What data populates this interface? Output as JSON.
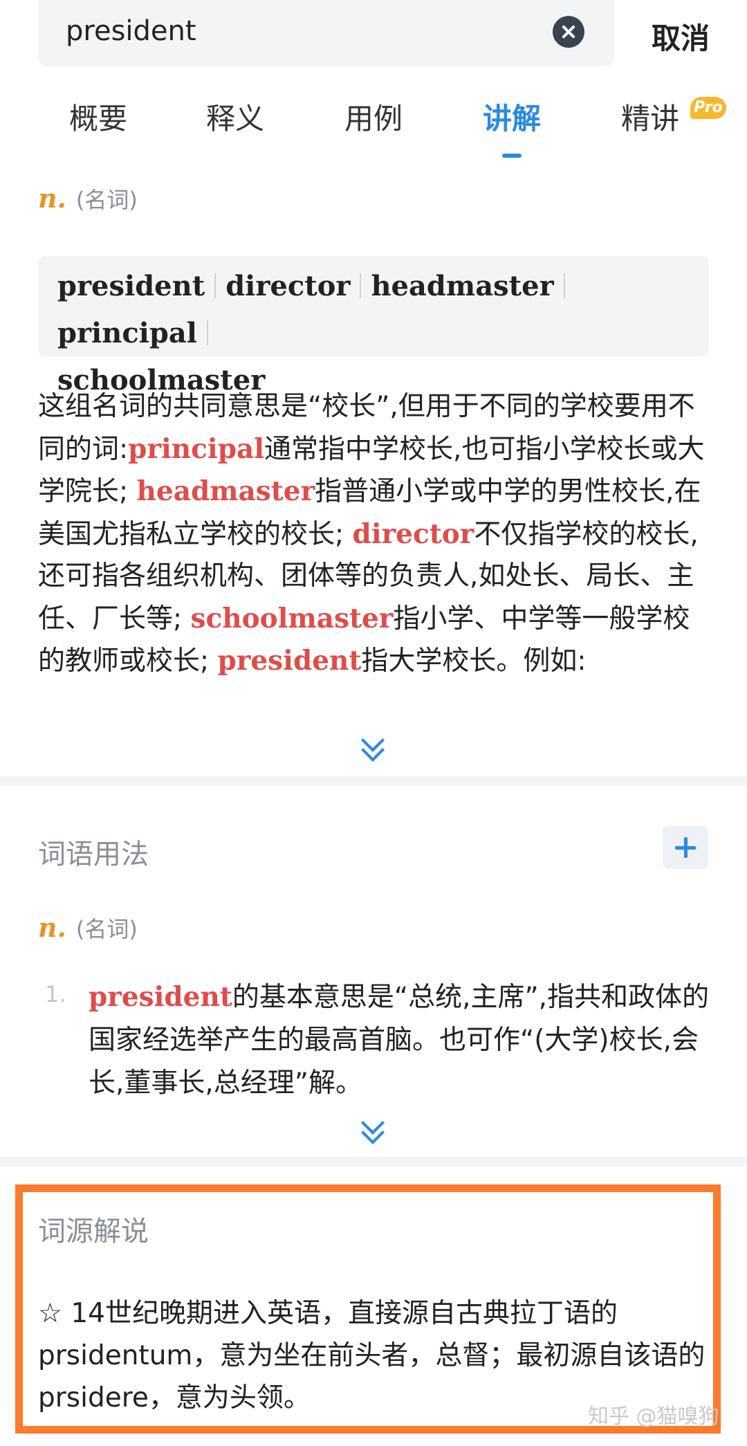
{
  "search": {
    "query": "president",
    "cancel_label": "取消"
  },
  "tabs": [
    {
      "label": "概要"
    },
    {
      "label": "释义"
    },
    {
      "label": "用例"
    },
    {
      "label": "讲解",
      "active": true
    },
    {
      "label": "精讲",
      "badge": "Pro"
    }
  ],
  "explanation": {
    "pos_abbr": "n.",
    "pos_label": "(名词)",
    "synonyms": [
      "president",
      "director",
      "headmaster",
      "principal",
      "schoolmaster"
    ],
    "text_parts": [
      "这组名词的共同意思是“校长”,但用于不同的学校要用不同的词:",
      "principal",
      "通常指中学校长,也可指小学校长或大学院长; ",
      "headmaster",
      "指普通小学或中学的男性校长,在美国尤指私立学校的校长; ",
      "director",
      "不仅指学校的校长,还可指各组织机构、团体等的负责人,如处长、局长、主任、厂长等; ",
      "schoolmaster",
      "指小学、中学等一般学校的教师或校长; ",
      "president",
      "指大学校长。例如:"
    ],
    "expand_icon": "double-chevron-down-icon"
  },
  "usage": {
    "title": "词语用法",
    "add_icon": "plus-icon",
    "pos_abbr": "n.",
    "pos_label": "(名词)",
    "items": [
      {
        "number": "1.",
        "keyword": "president",
        "text": "的基本意思是“总统,主席”,指共和政体的国家经选举产生的最高首脑。也可作“(大学)校长,会长,董事长,总经理”解。"
      }
    ]
  },
  "etymology": {
    "title": "词源解说",
    "text": "☆ 14世纪晚期进入英语，直接源自古典拉丁语的prsidentum，意为坐在前头者，总督；最初源自该语的prsidere，意为头领。"
  },
  "watermark": "知乎 @猫嗅狗",
  "colors": {
    "accent": "#2a8ae2",
    "highlight": "#de4d4a",
    "pos": "#e8922a",
    "frame": "#fb7a2c",
    "pro": "#f5b82e"
  }
}
